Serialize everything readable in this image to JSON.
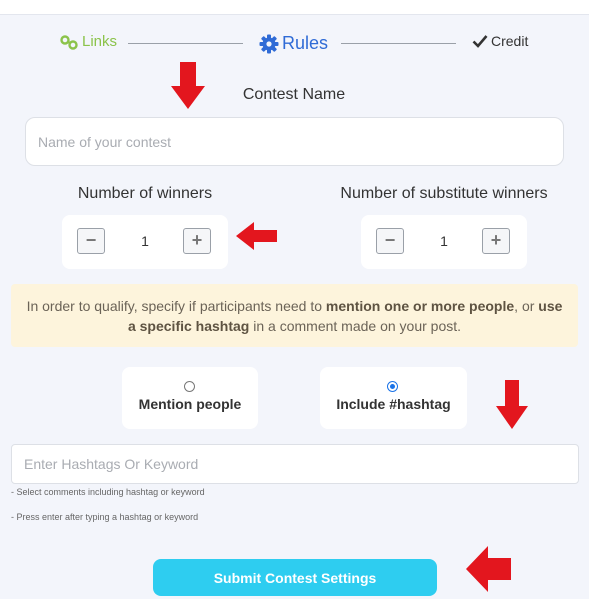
{
  "steps": {
    "links": "Links",
    "rules": "Rules",
    "credit": "Credit"
  },
  "colors": {
    "links_green": "#8bc34a",
    "rules_blue": "#2f6bd6",
    "arrow_red": "#e3161e",
    "notice_bg": "#fdf4dc",
    "submit_bg": "#2ecdf0"
  },
  "contest": {
    "title": "Contest Name",
    "placeholder": "Name of your contest"
  },
  "winners": {
    "title": "Number of winners",
    "value": "1",
    "minus": "−",
    "plus": "+"
  },
  "substitutes": {
    "title": "Number of substitute winners",
    "value": "1",
    "minus": "−",
    "plus": "+"
  },
  "notice": {
    "part1": "In order to qualify, specify if participants need to ",
    "bold1": "mention one or more people",
    "part2": ", or ",
    "bold2": "use a specific hashtag",
    "part3": " in a comment made on your post."
  },
  "options": {
    "mention": {
      "label": "Mention people",
      "selected": false
    },
    "hashtag": {
      "label": "Include #hashtag",
      "selected": true
    }
  },
  "hashtag_input": {
    "placeholder": "Enter Hashtags Or Keyword",
    "hint1": "- Select comments including hashtag or keyword",
    "hint2": "- Press enter after typing a hashtag or keyword"
  },
  "submit": {
    "label": "Submit Contest Settings"
  },
  "icons": [
    "link-icon",
    "gear-icon",
    "check-icon",
    "arrow-down-icon",
    "arrow-left-icon"
  ]
}
